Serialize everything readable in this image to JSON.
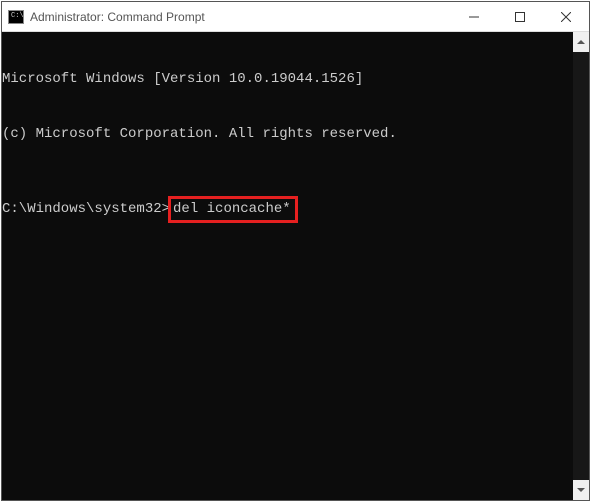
{
  "titlebar": {
    "icon_label": "C:\\",
    "title": "Administrator: Command Prompt"
  },
  "terminal": {
    "line1": "Microsoft Windows [Version 10.0.19044.1526]",
    "line2": "(c) Microsoft Corporation. All rights reserved.",
    "prompt": "C:\\Windows\\system32>",
    "command": "del iconcache*"
  }
}
